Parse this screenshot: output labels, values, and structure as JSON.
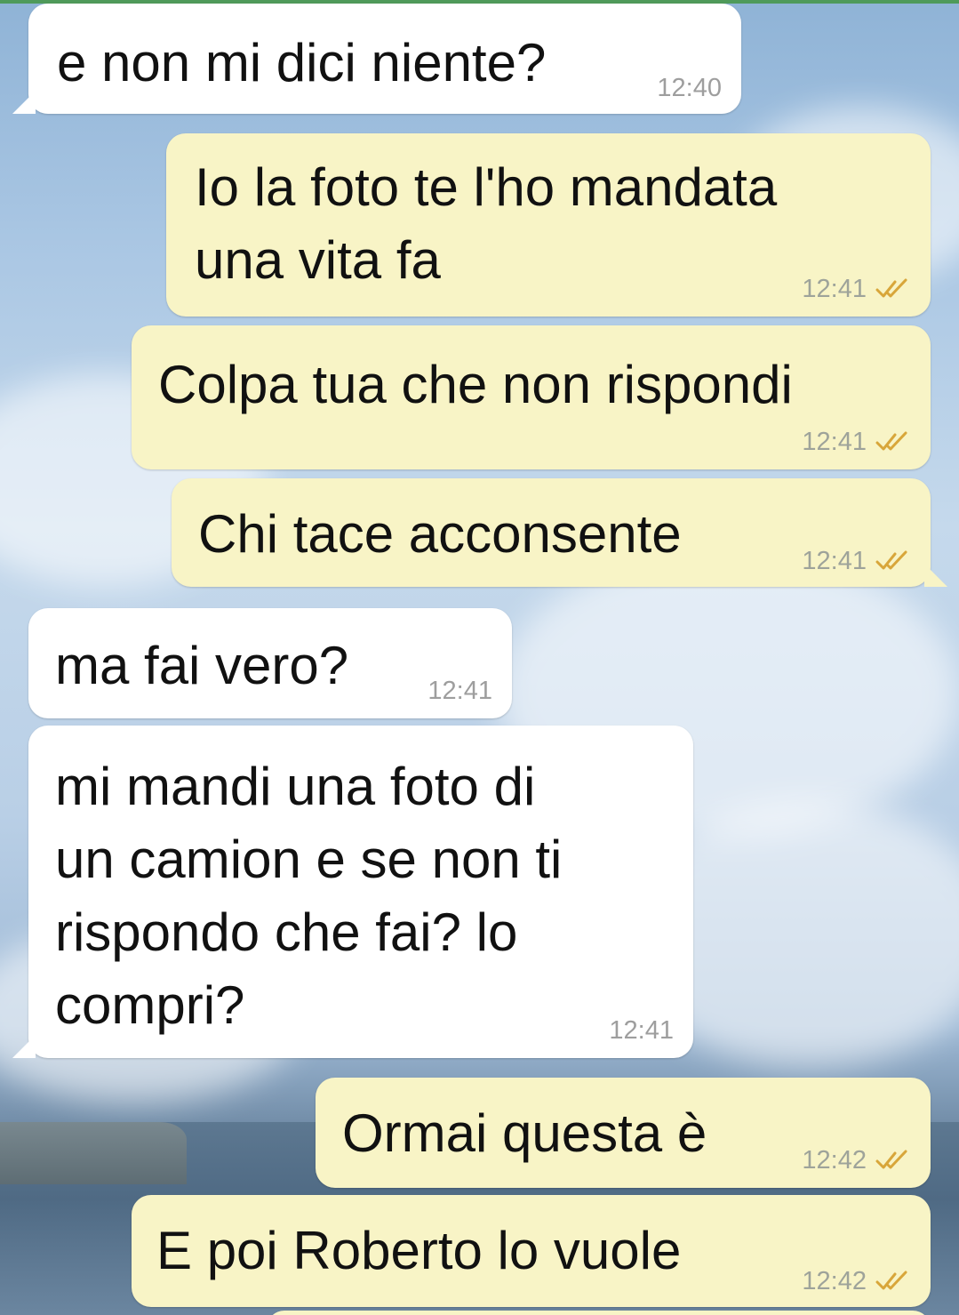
{
  "chat": {
    "messages": [
      {
        "direction": "in",
        "text": "e non mi dici niente?",
        "time": "12:40"
      },
      {
        "direction": "out",
        "text": "Io la foto te l'ho mandata\nuna vita fa",
        "time": "12:41",
        "status": "read",
        "status_icon": "double-check-icon"
      },
      {
        "direction": "out",
        "text": "Colpa tua che non rispondi",
        "time": "12:41",
        "status": "read",
        "status_icon": "double-check-icon"
      },
      {
        "direction": "out",
        "text": "Chi tace acconsente",
        "time": "12:41",
        "status": "read",
        "status_icon": "double-check-icon"
      },
      {
        "direction": "in",
        "text": "ma fai vero?",
        "time": "12:41"
      },
      {
        "direction": "in",
        "text": "mi mandi una foto di\nun camion e se non ti\nrispondo che fai? lo\ncompri?",
        "time": "12:41"
      },
      {
        "direction": "out",
        "text": "Ormai questa è",
        "time": "12:42",
        "status": "read",
        "status_icon": "double-check-icon"
      },
      {
        "direction": "out",
        "text": "E poi Roberto lo vuole",
        "time": "12:42",
        "status": "read",
        "status_icon": "double-check-icon"
      }
    ]
  },
  "colors": {
    "incoming_bubble": "#ffffff",
    "outgoing_bubble": "#f8f4c6",
    "read_tick": "#d8a63a",
    "timestamp": "#9e9e9e"
  }
}
